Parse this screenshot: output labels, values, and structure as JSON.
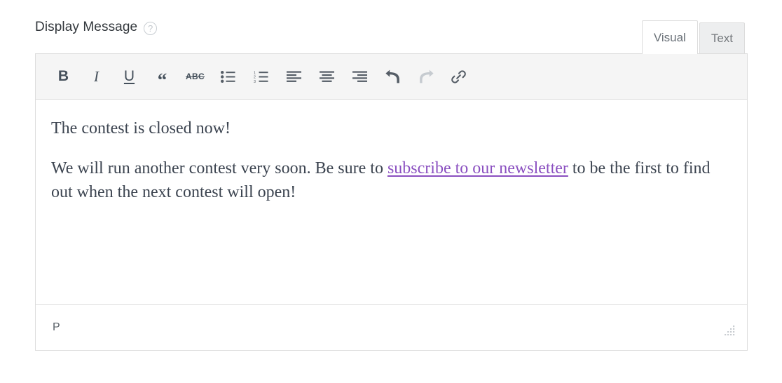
{
  "field": {
    "label": "Display Message",
    "help_icon": "question-mark-circle-icon",
    "help_icon_glyph": "?"
  },
  "editor": {
    "tabs": [
      {
        "id": "visual",
        "label": "Visual",
        "active": true
      },
      {
        "id": "text",
        "label": "Text",
        "active": false
      }
    ],
    "toolbar": {
      "buttons": [
        {
          "id": "bold",
          "icon": "bold-icon",
          "glyph": "B",
          "title": "Bold",
          "disabled": false
        },
        {
          "id": "italic",
          "icon": "italic-icon",
          "glyph": "I",
          "title": "Italic",
          "disabled": false
        },
        {
          "id": "underline",
          "icon": "underline-icon",
          "glyph": "U",
          "title": "Underline",
          "disabled": false
        },
        {
          "id": "blockquote",
          "icon": "blockquote-icon",
          "glyph": "“",
          "title": "Blockquote",
          "disabled": false
        },
        {
          "id": "strikethrough",
          "icon": "strikethrough-icon",
          "glyph": "ABC",
          "title": "Strikethrough",
          "disabled": false
        },
        {
          "id": "bullet-list",
          "icon": "unordered-list-icon",
          "glyph": "",
          "title": "Bulleted list",
          "disabled": false
        },
        {
          "id": "numbered-list",
          "icon": "ordered-list-icon",
          "glyph": "",
          "title": "Numbered list",
          "disabled": false
        },
        {
          "id": "align-left",
          "icon": "align-left-icon",
          "glyph": "",
          "title": "Align left",
          "disabled": false
        },
        {
          "id": "align-center",
          "icon": "align-center-icon",
          "glyph": "",
          "title": "Align center",
          "disabled": false
        },
        {
          "id": "align-right",
          "icon": "align-right-icon",
          "glyph": "",
          "title": "Align right",
          "disabled": false
        },
        {
          "id": "undo",
          "icon": "undo-icon",
          "glyph": "",
          "title": "Undo",
          "disabled": false
        },
        {
          "id": "redo",
          "icon": "redo-icon",
          "glyph": "",
          "title": "Redo",
          "disabled": true
        },
        {
          "id": "insert-link",
          "icon": "link-icon",
          "glyph": "",
          "title": "Insert/edit link",
          "disabled": false
        }
      ]
    },
    "content": {
      "paragraph_1": "The contest is closed now!",
      "paragraph_2_before_link": "We will run another contest very soon. Be sure to ",
      "paragraph_2_link": "subscribe to our newsletter",
      "paragraph_2_after_link": " to be the first to find out when the next contest will open!"
    },
    "statusbar": {
      "path": "P",
      "resize_handle": "resize-grip-icon"
    }
  },
  "colors": {
    "link": "#8a4fc0",
    "text": "#3c4450",
    "label": "#32373c",
    "toolbar_bg": "#f5f5f5",
    "border": "#dddddd",
    "tab_inactive_bg": "#edeeef",
    "icon": "#555d66",
    "icon_disabled": "#c6cbd0"
  }
}
